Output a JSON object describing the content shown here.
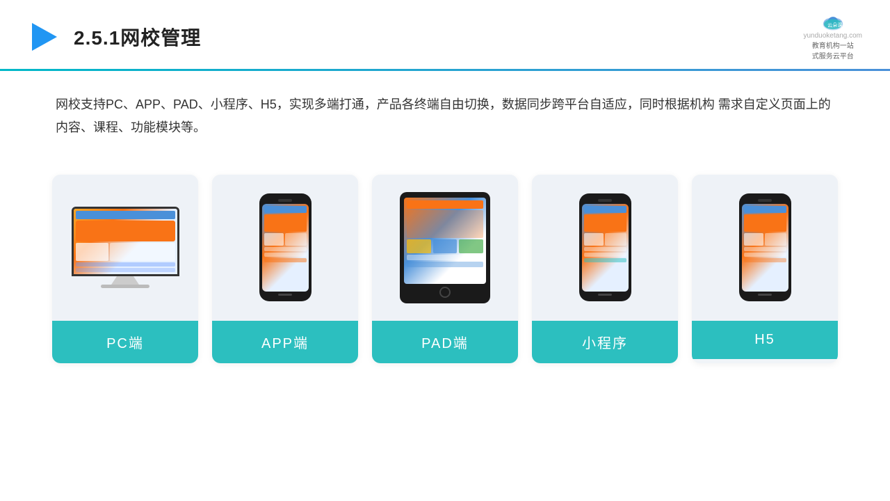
{
  "header": {
    "title": "2.5.1网校管理",
    "logo_name": "云朵课堂",
    "logo_url": "yunduoketang.com",
    "logo_tagline": "教育机构一站\n式服务云平台"
  },
  "description": {
    "text": "网校支持PC、APP、PAD、小程序、H5，实现多端打通，产品各终端自由切换，数据同步跨平台自适应，同时根据机构\n需求自定义页面上的内容、课程、功能模块等。"
  },
  "cards": [
    {
      "id": "pc",
      "label": "PC端",
      "type": "pc"
    },
    {
      "id": "app",
      "label": "APP端",
      "type": "phone"
    },
    {
      "id": "pad",
      "label": "PAD端",
      "type": "tablet"
    },
    {
      "id": "miniprogram",
      "label": "小程序",
      "type": "phone"
    },
    {
      "id": "h5",
      "label": "H5",
      "type": "phone"
    }
  ],
  "colors": {
    "teal": "#2cbfbf",
    "blue": "#4a90d9",
    "divider_start": "#00b8c8",
    "divider_end": "#4a90d9",
    "background": "#f0f4f8"
  }
}
